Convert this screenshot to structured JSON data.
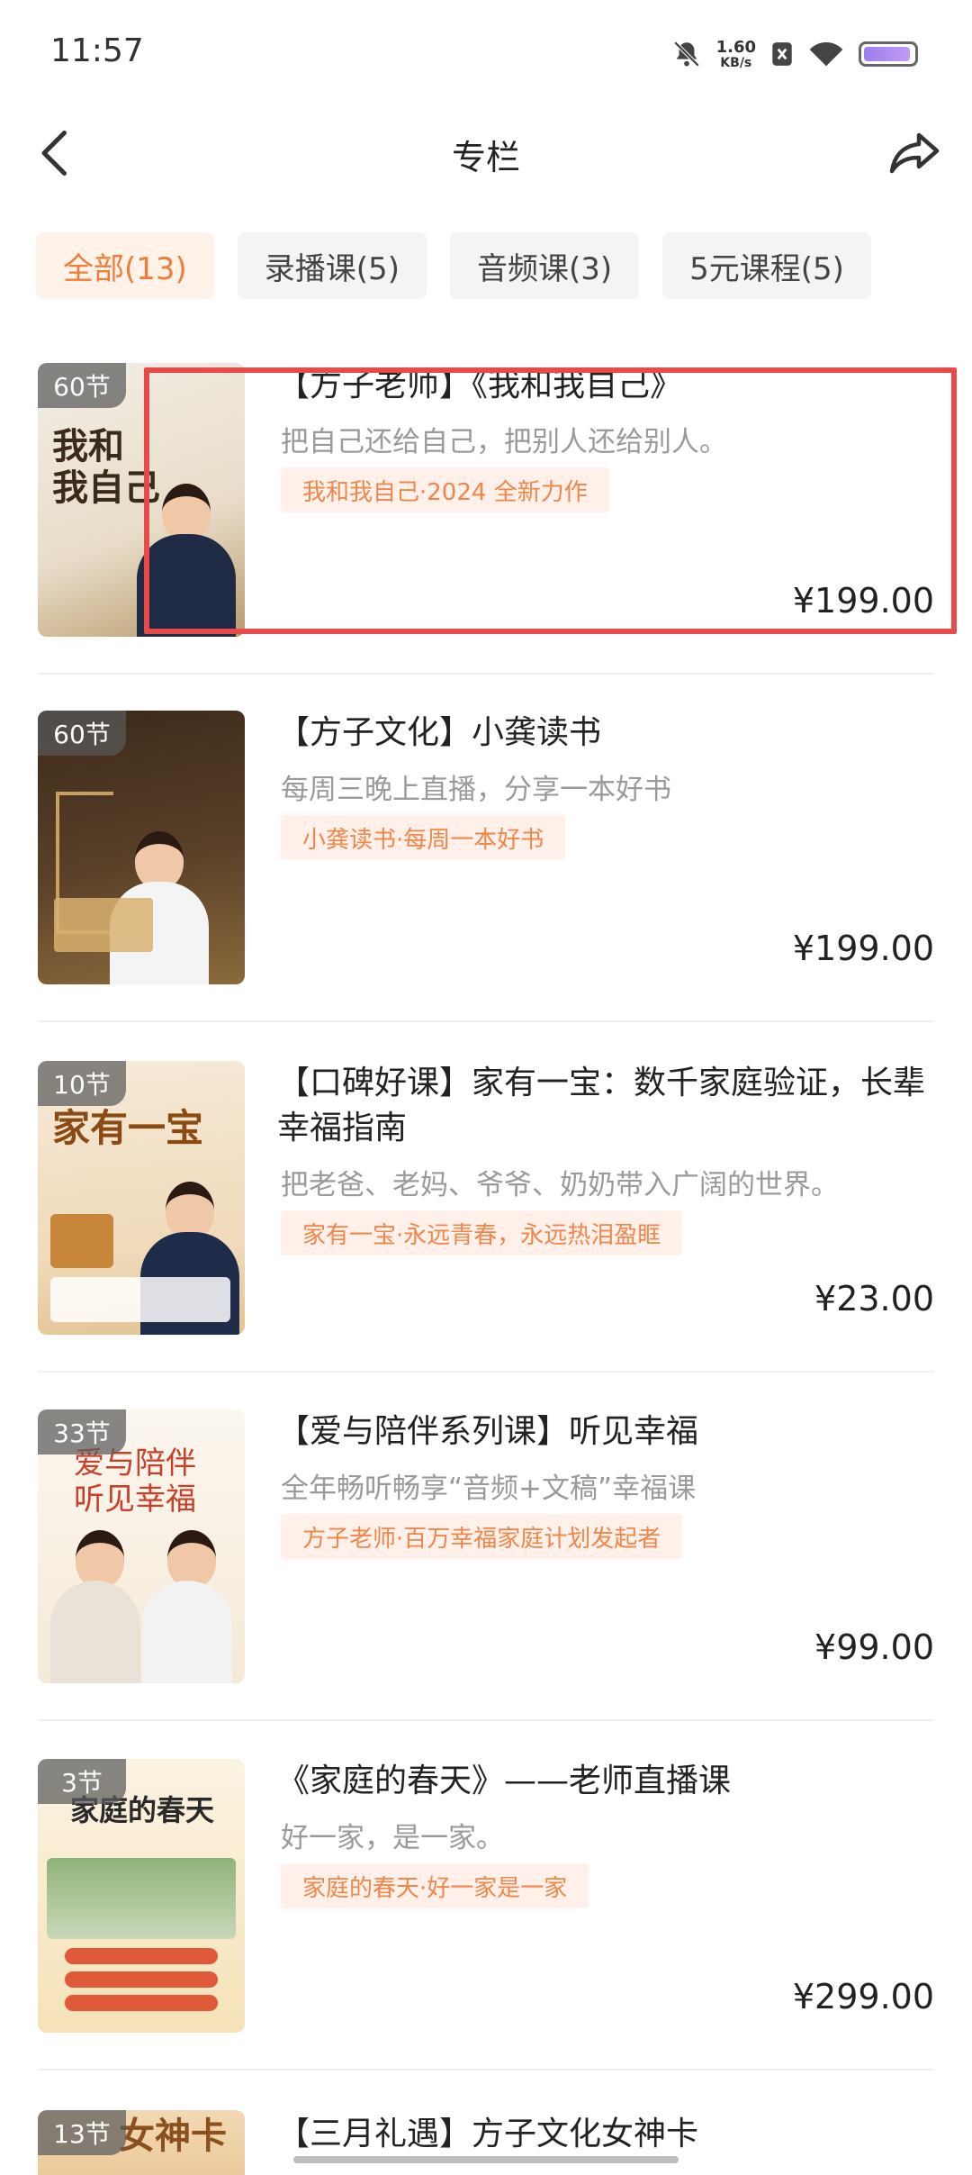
{
  "status_bar": {
    "time": "11:57",
    "net_speed_value": "1.60",
    "net_speed_unit": "KB/s"
  },
  "nav": {
    "title": "专栏"
  },
  "tabs": [
    {
      "label": "全部(13)",
      "active": true
    },
    {
      "label": "录播课(5)",
      "active": false
    },
    {
      "label": "音频课(3)",
      "active": false
    },
    {
      "label": "5元课程(5)",
      "active": false
    }
  ],
  "courses": [
    {
      "lessons": "60节",
      "thumb_text": "我和\n我自己",
      "title": "【方子老师】《我和我自己》",
      "subtitle": "把自己还给自己，把别人还给别人。",
      "tag": "我和我自己·2024 全新力作",
      "price": "¥199.00"
    },
    {
      "lessons": "60节",
      "thumb_text": "",
      "title": "【方子文化】小龚读书",
      "subtitle": "每周三晚上直播，分享一本好书",
      "tag": "小龚读书·每周一本好书",
      "price": "¥199.00"
    },
    {
      "lessons": "10节",
      "thumb_text": "家有一宝",
      "title": "【口碑好课】家有一宝：数千家庭验证，长辈幸福指南",
      "subtitle": "把老爸、老妈、爷爷、奶奶带入广阔的世界。",
      "tag": "家有一宝·永远青春，永远热泪盈眶",
      "price": "¥23.00"
    },
    {
      "lessons": "33节",
      "thumb_text": "爱与陪伴\n听见幸福",
      "title": "【爱与陪伴系列课】听见幸福",
      "subtitle": "全年畅听畅享“音频+文稿”幸福课",
      "tag": "方子老师·百万幸福家庭计划发起者",
      "price": "¥99.00"
    },
    {
      "lessons": "3节",
      "thumb_text": "家庭的春天",
      "title": "《家庭的春天》——老师直播课",
      "subtitle": "好一家，是一家。",
      "tag": "家庭的春天·好一家是一家",
      "price": "¥299.00"
    },
    {
      "lessons": "13节",
      "thumb_text": "女神卡",
      "title": "【三月礼遇】方子文化女神卡",
      "subtitle": "",
      "tag": "",
      "price": ""
    }
  ],
  "colors": {
    "accent": "#f07c3a",
    "tag_bg": "#fff1ea",
    "highlight": "#e84a4a"
  }
}
